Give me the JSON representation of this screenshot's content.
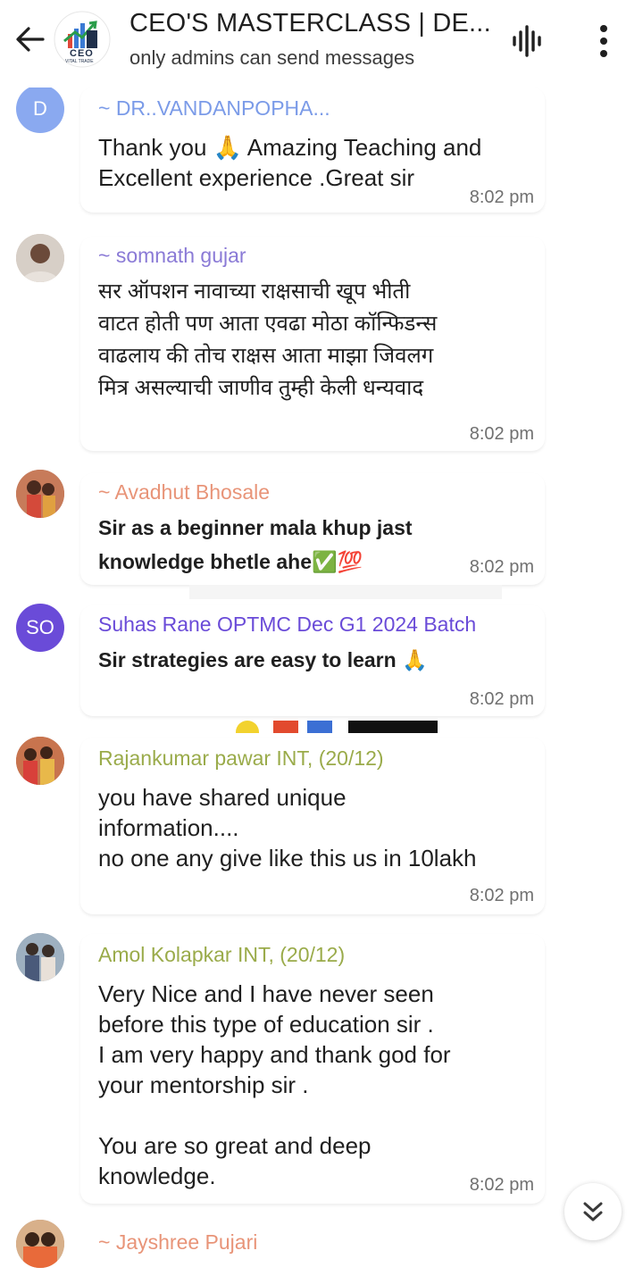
{
  "header": {
    "title": "CEO'S MASTERCLASS | DE...",
    "subtitle": "only admins can send messages",
    "logo_text": "CEO",
    "logo_subtext": "VITAL TRADE"
  },
  "messages": [
    {
      "avatar_initials": "D",
      "avatar_color": "#8aa9f0",
      "sender": "~ DR..VANDANPOPHA...",
      "sender_color": "#7b9be8",
      "text": "Thank you 🙏 Amazing Teaching and\nExcellent experience .Great sir",
      "time": "8:02 pm"
    },
    {
      "avatar_initials": "",
      "avatar_color": "#c9b6a6",
      "sender": "~ somnath gujar",
      "sender_color": "#8a7ad6",
      "text": "सर ऑपशन नावाच्या राक्षसाची खूप भीती\nवाटत होती पण आता एवढा मोठा कॉन्फिडन्स\nवाढलाय की तोच राक्षस आता माझा जिवलग\nमित्र असल्याची जाणीव तुम्ही केली धन्यवाद",
      "time": "8:02 pm"
    },
    {
      "avatar_initials": "",
      "avatar_color": "#b0705a",
      "sender": "~ Avadhut Bhosale",
      "sender_color": "#e89478",
      "text": "Sir as a beginner mala khup jast\nknowledge bhetle ahe✅💯",
      "time": "8:02 pm"
    },
    {
      "avatar_initials": "SO",
      "avatar_color": "#6a4bd8",
      "sender": "Suhas Rane OPTMC Dec G1 2024 Batch",
      "sender_color": "#6a4bd8",
      "text": "Sir strategies are easy to learn 🙏",
      "time": "8:02 pm"
    },
    {
      "avatar_initials": "",
      "avatar_color": "#a85a40",
      "sender": "Rajankumar pawar INT, (20/12)",
      "sender_color": "#9aab4a",
      "text": "you have shared unique\ninformation....\nno one any give like this us in 10lakh",
      "time": "8:02 pm"
    },
    {
      "avatar_initials": "",
      "avatar_color": "#7a8a9a",
      "sender": "Amol Kolapkar INT, (20/12)",
      "sender_color": "#9aab4a",
      "text": "Very Nice and I have never seen\nbefore this type of education sir .\nI am very happy and thank god for\nyour mentorship sir .\n\nYou are so great and deep\nknowledge.",
      "time": "8:02 pm"
    },
    {
      "avatar_initials": "",
      "avatar_color": "#b88a70",
      "sender": "~ Jayshree Pujari",
      "sender_color": "#e89478"
    }
  ],
  "icons": {
    "back": "arrow-left-icon",
    "voice": "voice-waveform-icon",
    "more": "more-vertical-icon",
    "scroll": "double-chevron-down-icon"
  }
}
